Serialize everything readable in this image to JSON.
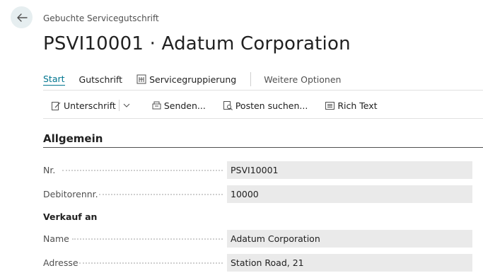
{
  "header": {
    "caption": "Gebuchte Servicegutschrift",
    "title": "PSVI10001 · Adatum Corporation"
  },
  "actions": [
    {
      "label": "Start"
    },
    {
      "label": "Gutschrift"
    },
    {
      "label": "Servicegruppierung"
    },
    {
      "label": "Weitere Optionen"
    }
  ],
  "toolbar": [
    {
      "label": "Unterschrift"
    },
    {
      "label": "Senden..."
    },
    {
      "label": "Posten suchen..."
    },
    {
      "label": "Rich Text"
    }
  ],
  "section": {
    "title": "Allgemein",
    "fields": [
      {
        "label": "Nr.",
        "value": "PSVI10001"
      },
      {
        "label": "Debitorennr.",
        "value": "10000"
      }
    ],
    "group_label": "Verkauf an",
    "group_fields": [
      {
        "label": "Name",
        "value": "Adatum Corporation"
      },
      {
        "label": "Adresse",
        "value": "Station Road, 21"
      }
    ]
  }
}
